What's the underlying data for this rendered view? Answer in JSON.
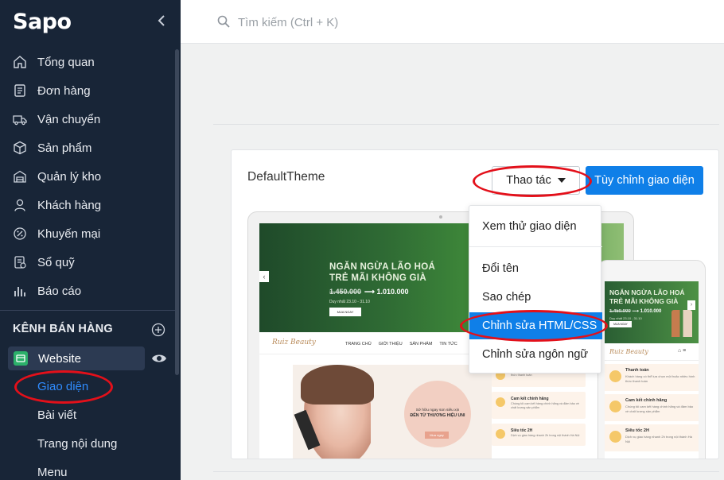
{
  "brand": "Sapo",
  "sidebar": {
    "items": [
      {
        "label": "Tổng quan",
        "icon": "home-icon"
      },
      {
        "label": "Đơn hàng",
        "icon": "receipt-icon"
      },
      {
        "label": "Vận chuyển",
        "icon": "truck-icon"
      },
      {
        "label": "Sản phẩm",
        "icon": "box-icon"
      },
      {
        "label": "Quản lý kho",
        "icon": "warehouse-icon"
      },
      {
        "label": "Khách hàng",
        "icon": "user-icon"
      },
      {
        "label": "Khuyến mại",
        "icon": "discount-icon"
      },
      {
        "label": "Sổ quỹ",
        "icon": "cashbook-icon"
      },
      {
        "label": "Báo cáo",
        "icon": "chart-icon"
      }
    ],
    "section_title": "KÊNH BÁN HÀNG",
    "channel": "Website",
    "sub_items": [
      "Giao diện",
      "Bài viết",
      "Trang nội dung",
      "Menu"
    ]
  },
  "search": {
    "placeholder": "Tìm kiếm (Ctrl + K)"
  },
  "theme": {
    "name": "DefaultTheme",
    "actions_label": "Thao tác",
    "customize_label": "Tùy chỉnh giao diện"
  },
  "dropdown": {
    "items": [
      "Xem thử giao diện",
      "Đổi tên",
      "Sao chép",
      "Chỉnh sửa HTML/CSS",
      "Chỉnh sửa ngôn ngữ"
    ],
    "selected": "Chỉnh sửa HTML/CSS"
  },
  "preview": {
    "hero_line1": "NGĂN NGỪA LÃO HOÁ",
    "hero_line2": "TRẺ MÃI KHÔNG GIÀ",
    "old_price": "1.450.000",
    "new_price": "1.010.000",
    "date": "Duy nhất 23.10 - 31.10",
    "hero_button": "MUA NGAY",
    "logo": "Ruiz Beauty",
    "menu": [
      "TRANG CHỦ",
      "GIỚI THIỆU",
      "SẢN PHẨM",
      "TIN TỨC"
    ],
    "promo_small": "Sở hữu ngay son siêu xịn",
    "promo_big": "ĐẾN TỪ THƯƠNG HIỆU UNI",
    "promo_button": "Mua ngay",
    "features": [
      {
        "title": "",
        "desc": "Khách hàng có thể lựa chọn một hoặc nhiều hình thức thanh toán"
      },
      {
        "title": "Cam kết chính hãng",
        "desc": "Chúng tôi cam kết hàng chính hãng và đảm bảo về chất lượng sản phẩm"
      },
      {
        "title": "Siêu tốc 2H",
        "desc": "Dịch vụ giao hàng nhanh 2h trong nội thành Hà Nội"
      }
    ],
    "phone_features": [
      {
        "title": "Thanh toán",
        "desc": "Khách hàng có thể lựa chọn một hoặc nhiều hình thức thanh toán"
      },
      {
        "title": "Cam kết chính hãng",
        "desc": "Chúng tôi cam kết hàng chính hãng và đảm bảo về chất lượng sản phẩm"
      },
      {
        "title": "Siêu tốc 2H",
        "desc": "Dịch vụ giao hàng nhanh 2h trong nội thành Hà Nội"
      }
    ]
  },
  "colors": {
    "sidebar_bg": "#182537",
    "accent": "#0f7fe8",
    "annotation": "#e3101a",
    "active_link": "#2f8cff"
  }
}
